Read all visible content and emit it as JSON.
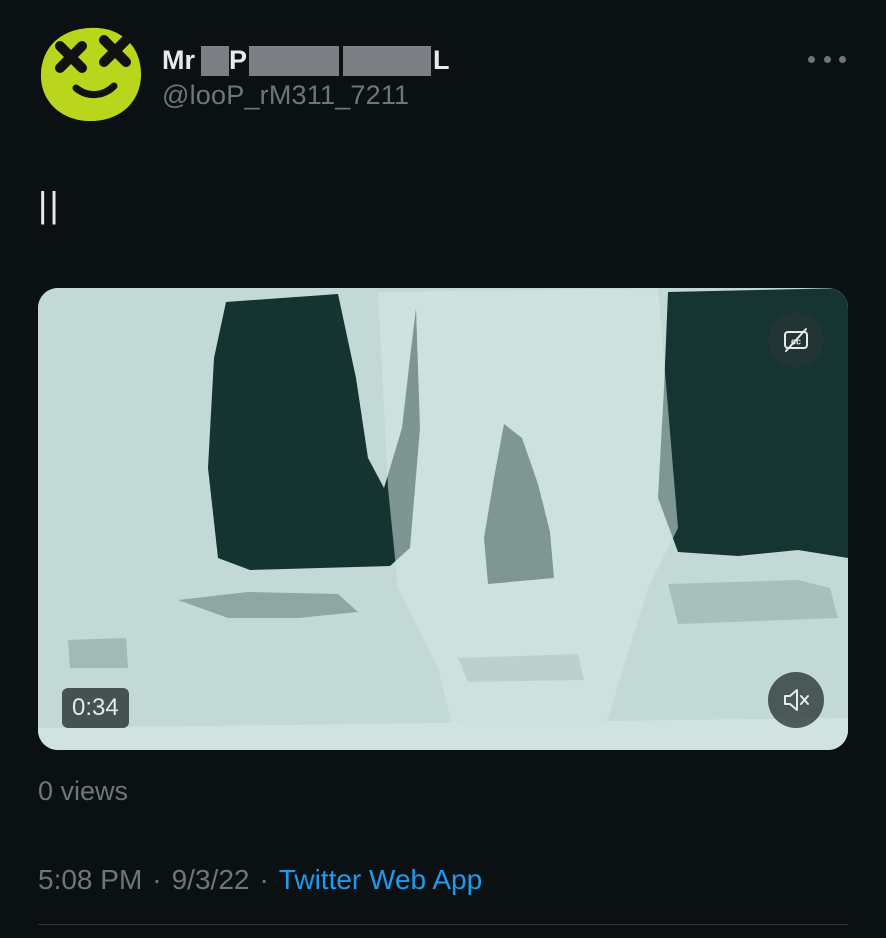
{
  "header": {
    "avatar_icon": "dizzy-face-icon",
    "display_name_start": "Mr",
    "display_name_mid": "P",
    "display_name_end": "L",
    "handle": "@looP_rM311_7211",
    "more_icon": "more-horizontal-icon"
  },
  "tweet": {
    "text": "||"
  },
  "video": {
    "duration": "0:34",
    "captions_icon": "captions-off-icon",
    "mute_icon": "volume-muted-icon"
  },
  "stats": {
    "views": "0 views"
  },
  "meta": {
    "time": "5:08 PM",
    "separator": "·",
    "date": "9/3/22",
    "source": "Twitter Web App"
  },
  "colors": {
    "background": "#0b1112",
    "accent": "#1d9bf0",
    "secondary_text": "#6e767d",
    "avatar": "#b9d61c"
  }
}
